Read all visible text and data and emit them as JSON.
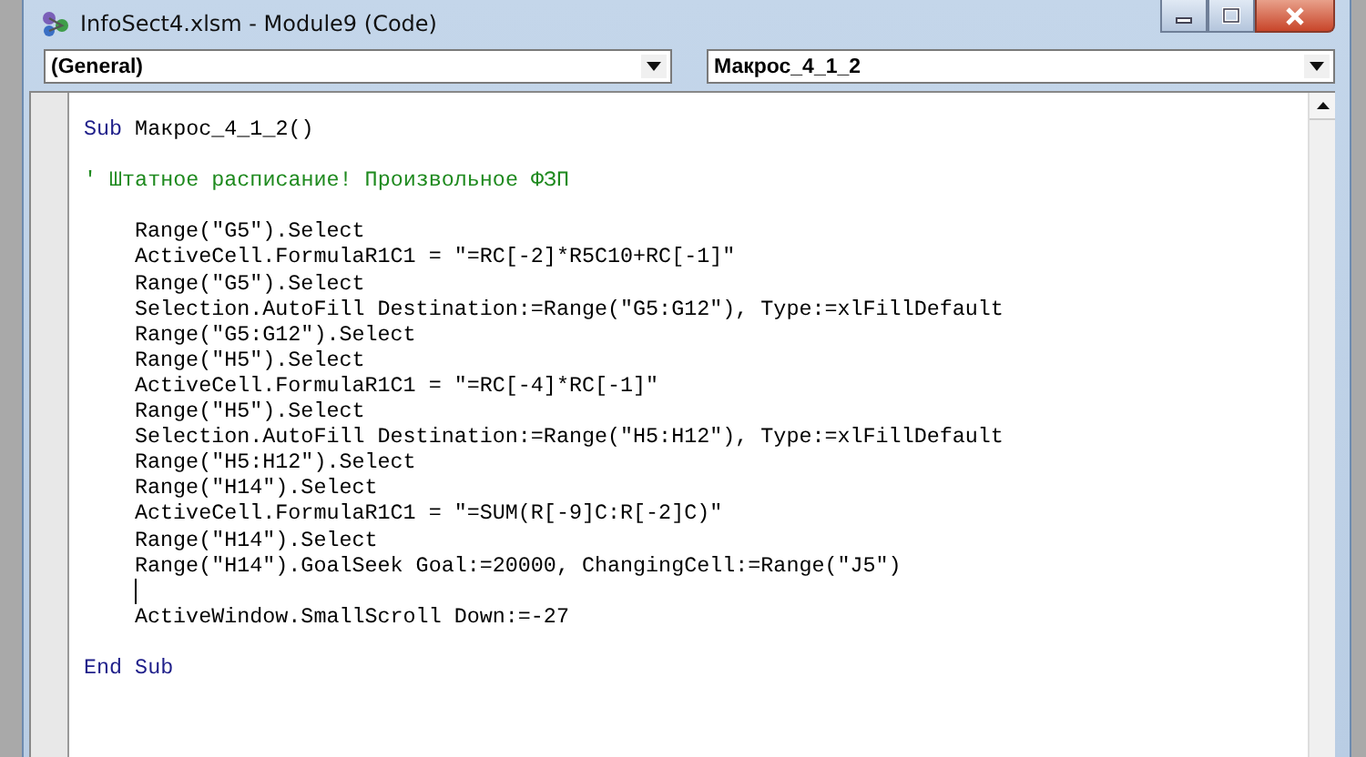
{
  "window": {
    "title": "InfoSect4.xlsm - Module9 (Code)"
  },
  "object_box": {
    "value": "(General)"
  },
  "procedure_box": {
    "value": "Макрос_4_1_2"
  },
  "code_lines": [
    {
      "kind": "keyword",
      "keyword": "Sub",
      "text": "Макрос_4_1_2()"
    },
    {
      "kind": "blank"
    },
    {
      "kind": "comment",
      "text": "' Штатное расписание! Произвольное ФЗП"
    },
    {
      "kind": "blank"
    },
    {
      "kind": "code",
      "text": "Range(\"G5\").Select"
    },
    {
      "kind": "code",
      "text": "ActiveCell.FormulaR1C1 = \"=RC[-2]*R5C10+RC[-1]\""
    },
    {
      "kind": "code",
      "text": "Range(\"G5\").Select"
    },
    {
      "kind": "code",
      "text": "Selection.AutoFill Destination:=Range(\"G5:G12\"), Type:=xlFillDefault"
    },
    {
      "kind": "code",
      "text": "Range(\"G5:G12\").Select"
    },
    {
      "kind": "code",
      "text": "Range(\"H5\").Select"
    },
    {
      "kind": "code",
      "text": "ActiveCell.FormulaR1C1 = \"=RC[-4]*RC[-1]\""
    },
    {
      "kind": "code",
      "text": "Range(\"H5\").Select"
    },
    {
      "kind": "code",
      "text": "Selection.AutoFill Destination:=Range(\"H5:H12\"), Type:=xlFillDefault"
    },
    {
      "kind": "code",
      "text": "Range(\"H5:H12\").Select"
    },
    {
      "kind": "code",
      "text": "Range(\"H14\").Select"
    },
    {
      "kind": "code",
      "text": "ActiveCell.FormulaR1C1 = \"=SUM(R[-9]C:R[-2]C)\""
    },
    {
      "kind": "code",
      "text": "Range(\"H14\").Select"
    },
    {
      "kind": "code",
      "text": "Range(\"H14\").GoalSeek Goal:=20000, ChangingCell:=Range(\"J5\")"
    },
    {
      "kind": "caret"
    },
    {
      "kind": "code",
      "text": "ActiveWindow.SmallScroll Down:=-27"
    },
    {
      "kind": "blank"
    },
    {
      "kind": "keyword",
      "keyword": "End Sub"
    }
  ]
}
